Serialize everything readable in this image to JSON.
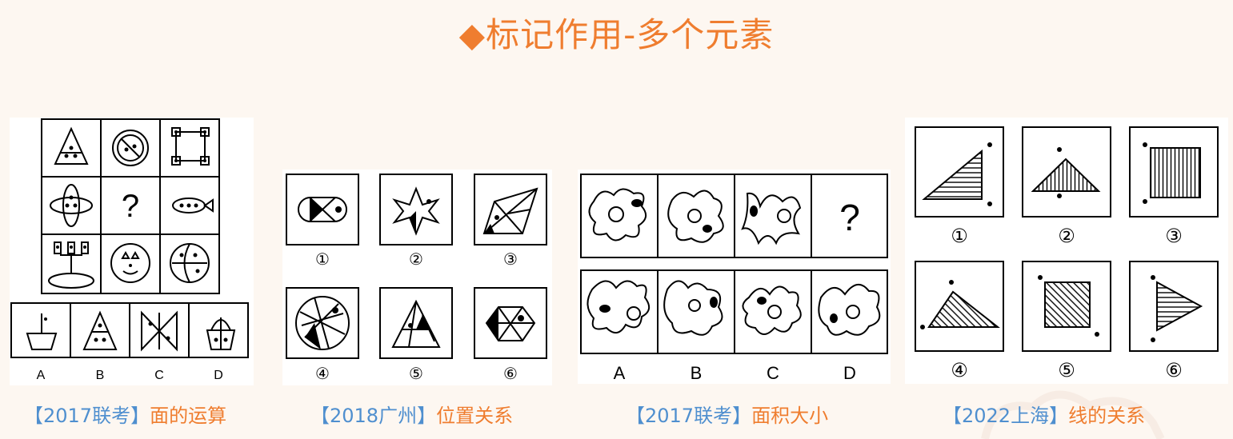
{
  "title": "◆标记作用-多个元素",
  "panels": [
    {
      "caption_source": "【2017联考】",
      "caption_topic": "面的运算",
      "grid_mark": "?",
      "options": [
        "A",
        "B",
        "C",
        "D"
      ]
    },
    {
      "caption_source": "【2018广州】",
      "caption_topic": "位置关系",
      "numbers": [
        "①",
        "②",
        "③",
        "④",
        "⑤",
        "⑥"
      ]
    },
    {
      "caption_source": "【2017联考】",
      "caption_topic": "面积大小",
      "grid_mark": "?",
      "options": [
        "A",
        "B",
        "C",
        "D"
      ]
    },
    {
      "caption_source": "【2022上海】",
      "caption_topic": "线的关系",
      "numbers": [
        "①",
        "②",
        "③",
        "④",
        "⑤",
        "⑥"
      ]
    }
  ],
  "colors": {
    "title": "#ef7d2f",
    "caption_source": "#4f8fcf",
    "caption_topic": "#ef7d2f",
    "background": "#fdf7f1"
  }
}
